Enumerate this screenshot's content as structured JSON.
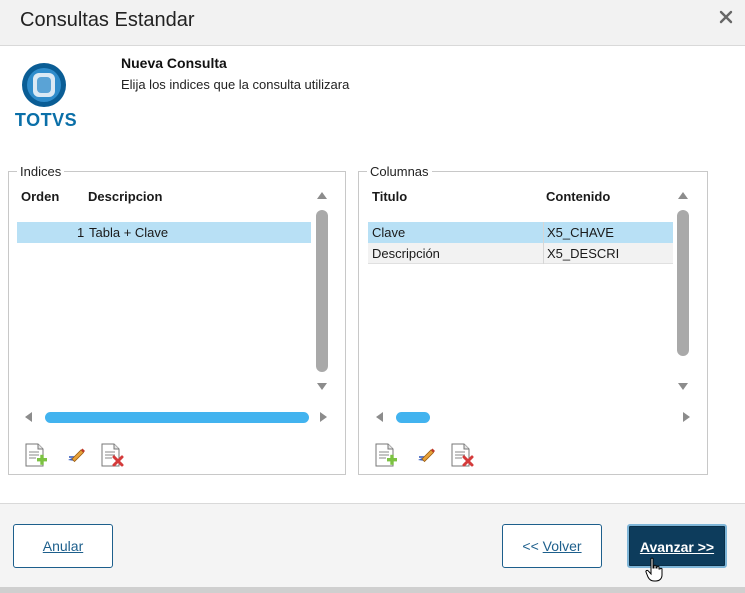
{
  "window": {
    "title": "Consultas Estandar",
    "close_icon": "close-icon"
  },
  "header": {
    "logo_text": "TOTVS",
    "title": "Nueva Consulta",
    "subtitle": "Elija los indices que la consulta utilizara"
  },
  "indices": {
    "legend": "Indices",
    "columns": [
      "Orden",
      "Descripcion"
    ],
    "rows": [
      {
        "orden": "1",
        "descripcion": "Tabla + Clave",
        "selected": true
      }
    ]
  },
  "columnas": {
    "legend": "Columnas",
    "columns": [
      "Titulo",
      "Contenido"
    ],
    "rows": [
      {
        "titulo": "Clave",
        "contenido": "X5_CHAVE",
        "selected": true
      },
      {
        "titulo": "Descripción",
        "contenido": "X5_DESCRI",
        "selected": false
      }
    ]
  },
  "toolbar_icons": [
    "add-document-icon",
    "edit-pencil-icon",
    "delete-document-icon"
  ],
  "footer": {
    "cancel_label": "Anular",
    "back_prefix": "<< ",
    "back_label": "Volver",
    "next_label": "Avanzar >>"
  },
  "colors": {
    "selected_row": "#b8e0f5",
    "accent": "#1d5f8c",
    "primary_button": "#0d3c5c",
    "logo": "#0a6fa8",
    "scroll_thumb": "#42b3ef"
  }
}
